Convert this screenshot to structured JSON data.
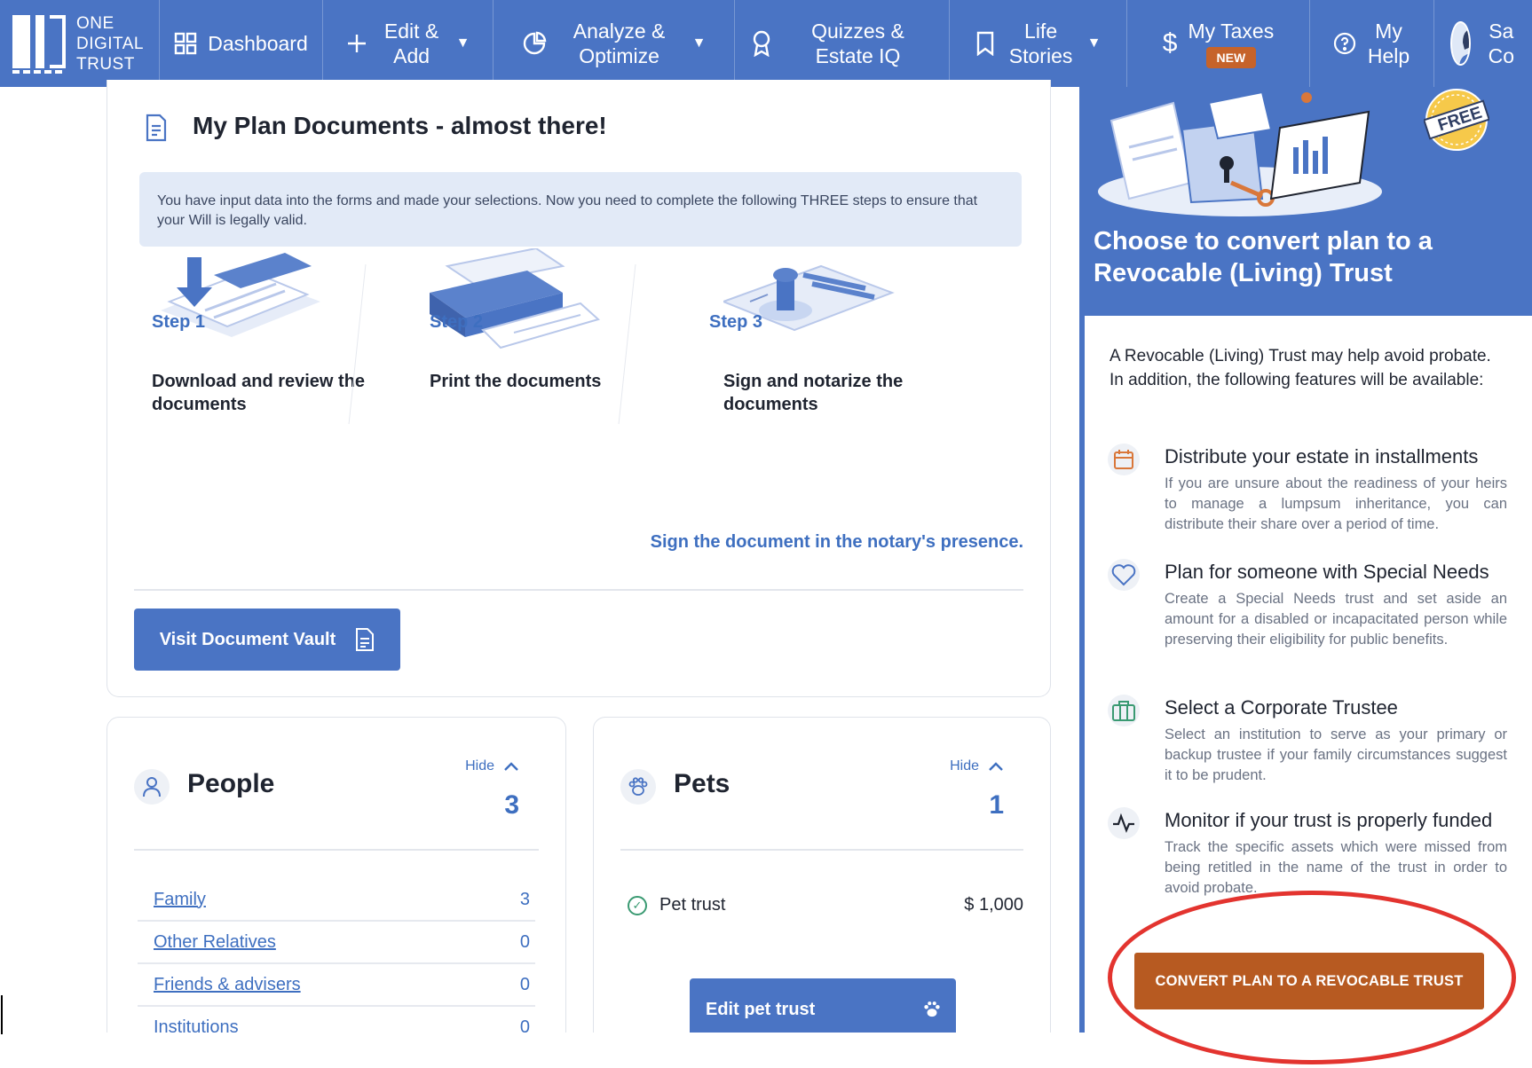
{
  "nav": {
    "logo_lines": [
      "ONE",
      "DIGITAL",
      "TRUST"
    ],
    "items": [
      {
        "label": "Dashboard",
        "icon": "grid-icon"
      },
      {
        "label": "Edit & Add",
        "icon": "plus-icon"
      },
      {
        "label": "Analyze & Optimize",
        "icon": "pie-chart-icon"
      },
      {
        "label": "Quizzes & Estate IQ",
        "icon": "award-icon"
      },
      {
        "label": "Life Stories",
        "icon": "bookmark-icon"
      },
      {
        "label": "My Taxes",
        "icon": "dollar-icon",
        "badge": "NEW"
      },
      {
        "label": "My Help",
        "icon": "help-circle-icon"
      }
    ],
    "user_name_partial": [
      "Sa",
      "Co"
    ]
  },
  "documents": {
    "title": "My Plan Documents - almost there!",
    "info": "You have input data into the forms and made your selections. Now you need to complete the following THREE steps to ensure that your Will is legally valid.",
    "steps": [
      {
        "text": "Download and review the documents",
        "num": "Step 1"
      },
      {
        "text": "Print the documents",
        "num": "Step 2"
      },
      {
        "text": "Sign and notarize the documents",
        "num": "Step 3"
      }
    ],
    "notary_note": "Sign the document in the notary's presence.",
    "vault_button": "Visit Document Vault"
  },
  "people": {
    "title": "People",
    "hide": "Hide",
    "count": "3",
    "rows": [
      {
        "label": "Family",
        "value": "3"
      },
      {
        "label": "Other Relatives",
        "value": "0"
      },
      {
        "label": "Friends & advisers",
        "value": "0"
      },
      {
        "label": "Institutions",
        "value": "0"
      }
    ]
  },
  "pets": {
    "title": "Pets",
    "hide": "Hide",
    "count": "1",
    "row_label": "Pet trust",
    "row_amount": "$ 1,000",
    "edit_button": "Edit pet trust"
  },
  "trust_panel": {
    "badge": "FREE",
    "title": "Choose to convert plan to a Revocable (Living) Trust",
    "intro": "A Revocable (Living) Trust may help avoid probate. In addition, the following features will be available:",
    "features": [
      {
        "icon": "calendar-icon",
        "title": "Distribute your estate in installments",
        "desc": "If you are unsure about the readiness of your heirs to manage a lumpsum inheritance, you can distribute their share over a period of time."
      },
      {
        "icon": "heart-icon",
        "title": "Plan for someone with Special Needs",
        "desc": "Create a Special Needs trust and set aside an amount for a disabled or incapacitated person while preserving their eligibility for public benefits."
      },
      {
        "icon": "briefcase-icon",
        "title": "Select a Corporate Trustee",
        "desc": "Select an institution to serve as your primary or backup trustee if your family circumstances suggest it to be prudent."
      },
      {
        "icon": "activity-icon",
        "title": "Monitor if your trust is properly funded",
        "desc": "Track the specific assets which were missed from being retitled in the name of the trust in order to avoid probate."
      }
    ],
    "convert_button": "CONVERT PLAN TO A REVOCABLE TRUST"
  },
  "colors": {
    "brand": "#4a74c4",
    "accent": "#b75a21",
    "link": "#3e6fc0",
    "annotation": "#e3342f"
  }
}
